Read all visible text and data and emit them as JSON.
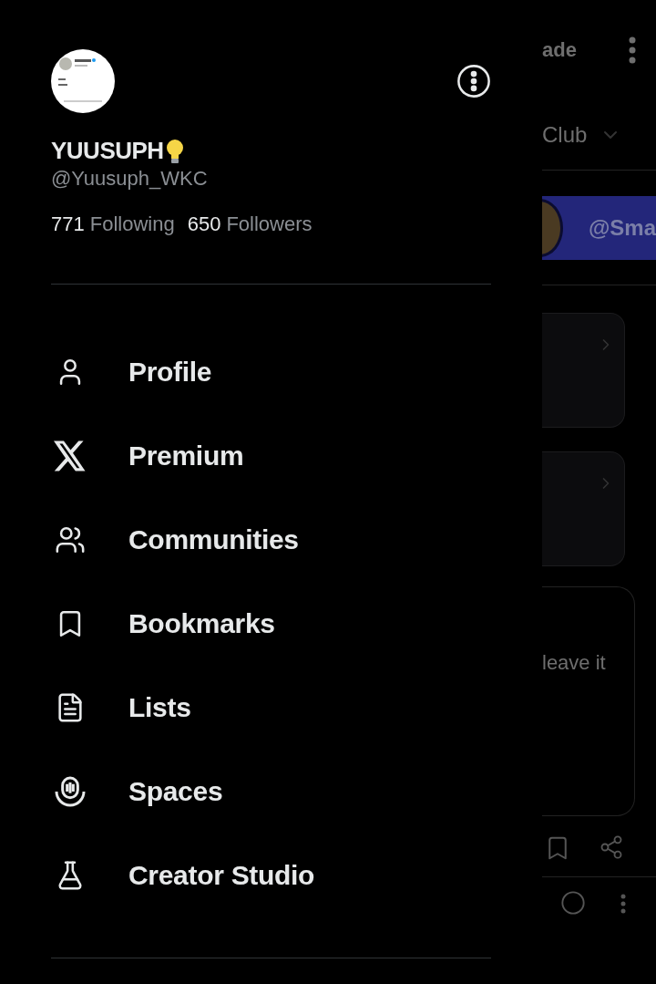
{
  "profile": {
    "name": "YUUSUPH",
    "handle": "@Yuusuph_WKC",
    "following_count": "771",
    "following_label": "Following",
    "followers_count": "650",
    "followers_label": "Followers"
  },
  "menu": [
    {
      "kind": "profile",
      "label": "Profile"
    },
    {
      "kind": "premium",
      "label": "Premium"
    },
    {
      "kind": "communities",
      "label": "Communities"
    },
    {
      "kind": "bookmarks",
      "label": "Bookmarks"
    },
    {
      "kind": "lists",
      "label": "Lists"
    },
    {
      "kind": "spaces",
      "label": "Spaces"
    },
    {
      "kind": "studio",
      "label": "Creator Studio"
    }
  ],
  "background": {
    "header_text": "ade",
    "tab_text": "Club",
    "banner_handle": "@Sma",
    "post_text": "leave it"
  }
}
